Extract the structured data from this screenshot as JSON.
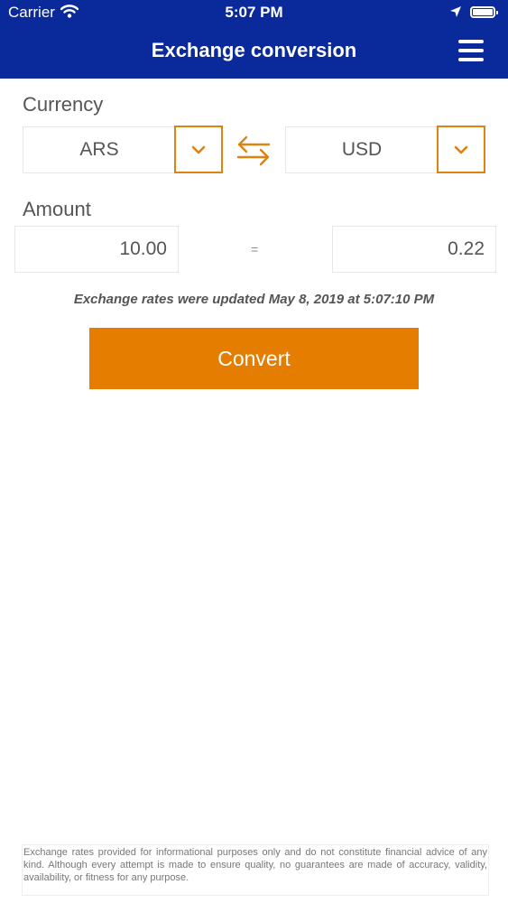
{
  "status_bar": {
    "carrier": "Carrier",
    "time": "5:07 PM"
  },
  "header": {
    "title": "Exchange conversion"
  },
  "currency": {
    "label": "Currency",
    "from": "ARS",
    "to": "USD"
  },
  "amount": {
    "label": "Amount",
    "from_value": "10.00",
    "equals": "=",
    "to_value": "0.22"
  },
  "updated_text": "Exchange rates were updated May 8, 2019 at 5:07:10 PM",
  "convert_label": "Convert",
  "disclaimer": "Exchange rates provided for informational purposes only and do not constitute financial advice of any kind. Although every attempt is made to ensure quality, no guarantees are made of accuracy, validity, availability, or fitness for any purpose.",
  "colors": {
    "header_bg": "#0a2a9c",
    "accent": "#e47d00"
  },
  "icons": [
    "wifi-icon",
    "location-icon",
    "battery-icon",
    "hamburger-menu-icon",
    "chevron-down-icon",
    "swap-arrows-icon"
  ]
}
